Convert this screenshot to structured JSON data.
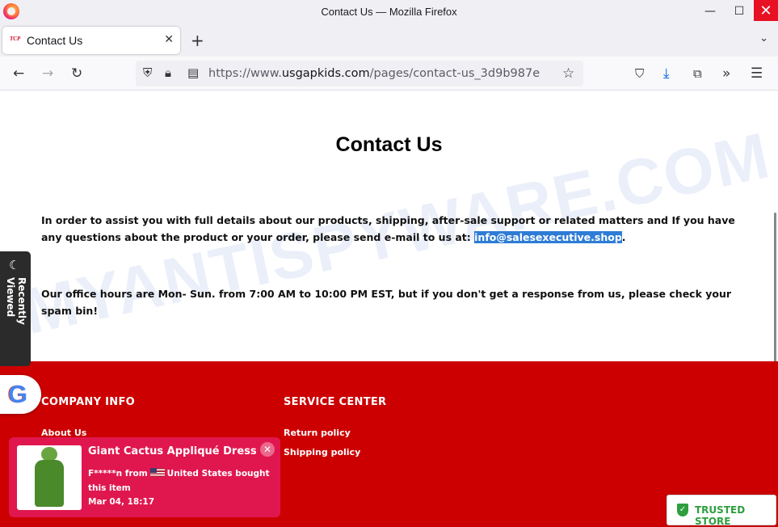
{
  "window": {
    "title": "Contact Us — Mozilla Firefox",
    "minimize": "—",
    "maximize": "☐",
    "close": "✕"
  },
  "tabs": [
    {
      "label": "Contact Us",
      "favicon_text": "TCP",
      "close": "✕"
    }
  ],
  "tabstrip": {
    "new_tab": "+",
    "list_all": "⌄"
  },
  "navbar": {
    "back": "←",
    "forward": "→",
    "reload": "↻",
    "url_prefix": "https://www.",
    "url_domain": "usgapkids.com",
    "url_path": "/pages/contact-us_3d9b987e",
    "bookmark": "☆",
    "pocket": "⛉",
    "download": "⤓",
    "extensions": "⧉",
    "overflow": "»",
    "menu": "☰"
  },
  "page": {
    "title": "Contact Us",
    "intro": "In order to assist you with full details about our products, shipping, after-sale support or related matters and If you have any questions about the product or your order, please send e-mail to us at: ",
    "email": "info@salesexecutive.shop",
    "intro_end": ".",
    "hours": "Our office hours are Mon- Sun. from 7:00 AM to 10:00 PM EST, but if you don't get a response from us, please check your spam bin!",
    "watermark": "MYANTISPYWARE.COM"
  },
  "footer": {
    "company_heading": "COMPANY INFO",
    "company_links": [
      "About Us"
    ],
    "service_heading": "SERVICE CENTER",
    "service_links": [
      "Return policy",
      "Shipping policy"
    ]
  },
  "recently_viewed": {
    "label": "Recently Viewed",
    "icon": "☾"
  },
  "google_badge": {
    "letter": "G"
  },
  "sales_popup": {
    "product": "Giant Cactus Appliqué Dress",
    "buyer": "F*****n from",
    "country": "United States bought this item",
    "date": "Mar 04, 18:17",
    "close": "✕"
  },
  "trusted_store": {
    "label": "TRUSTED STORE",
    "icon": "✓"
  },
  "colors": {
    "footer_red": "#cc0000",
    "popup_pink": "#e0174f",
    "selection_blue": "#2e7cd6",
    "trusted_green": "#2e9e3e"
  }
}
